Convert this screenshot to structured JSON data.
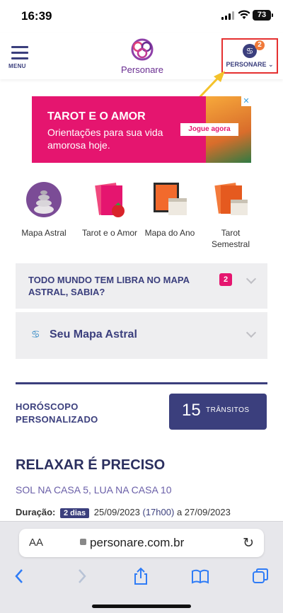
{
  "status": {
    "time": "16:39",
    "battery": "73"
  },
  "header": {
    "menu_label": "MENU",
    "logo_name": "Personare",
    "user_label": "PERSONARE",
    "notification_count": "2"
  },
  "banner": {
    "title": "TAROT E O AMOR",
    "text": "Orientações para sua vida amorosa hoje.",
    "cta": "Jogue agora",
    "close": "✕"
  },
  "tiles": [
    {
      "label": "Mapa Astral"
    },
    {
      "label": "Tarot e o Amor"
    },
    {
      "label": "Mapa do Ano"
    },
    {
      "label": "Tarot Semestral"
    }
  ],
  "accordions": {
    "a1_title": "TODO MUNDO TEM LIBRA NO MAPA ASTRAL, SABIA?",
    "a1_badge": "2",
    "a2_title": "Seu Mapa Astral",
    "a2_icon": "♋"
  },
  "horoscope": {
    "title": "HORÓSCOPO PERSONALIZADO",
    "transits_count": "15",
    "transits_label": "TRÂNSITOS",
    "event_title": "RELAXAR É PRECISO",
    "event_subtitle": "SOL NA CASA 5, LUA NA CASA 10",
    "duration_label": "Duração:",
    "duration_pill": "2 dias",
    "date_start": "25/09/2023",
    "time_start": "(17h00)",
    "date_sep": "a",
    "date_end": "27/09/2023"
  },
  "browser": {
    "aa": "AA",
    "url": "personare.com.br",
    "reload": "↻"
  },
  "colors": {
    "brand": "#3b3f7d",
    "pink": "#e5156f",
    "purple": "#6a2e91"
  }
}
